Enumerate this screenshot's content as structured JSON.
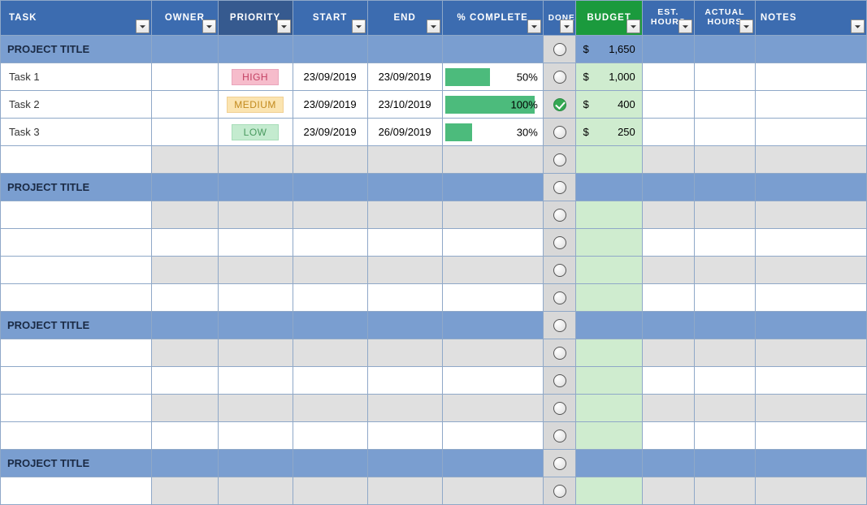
{
  "headers": {
    "task": "TASK",
    "owner": "OWNER",
    "priority": "PRIORITY",
    "start": "START",
    "end": "END",
    "pct": "% COMPLETE",
    "done": "DONE",
    "budget": "BUDGET",
    "est_hours": "EST. HOURS",
    "actual_hours": "ACTUAL HOURS",
    "notes": "NOTES"
  },
  "sections": [
    {
      "title": "PROJECT TITLE",
      "budget_currency": "$",
      "budget_total": "1,650",
      "tasks": [
        {
          "name": "Task 1",
          "priority": "HIGH",
          "prio_class": "prio-high",
          "start": "23/09/2019",
          "end": "23/09/2019",
          "pct": 50,
          "pct_text": "50%",
          "done": false,
          "currency": "$",
          "budget": "1,000"
        },
        {
          "name": "Task 2",
          "priority": "MEDIUM",
          "prio_class": "prio-medium",
          "start": "23/09/2019",
          "end": "23/10/2019",
          "pct": 100,
          "pct_text": "100%",
          "done": true,
          "currency": "$",
          "budget": "400"
        },
        {
          "name": "Task 3",
          "priority": "LOW",
          "prio_class": "prio-low",
          "start": "23/09/2019",
          "end": "26/09/2019",
          "pct": 30,
          "pct_text": "30%",
          "done": false,
          "currency": "$",
          "budget": "250"
        }
      ],
      "blank_rows_after": 1
    },
    {
      "title": "PROJECT TITLE",
      "tasks": [],
      "blank_rows_after": 4
    },
    {
      "title": "PROJECT TITLE",
      "tasks": [],
      "blank_rows_after": 4
    },
    {
      "title": "PROJECT TITLE",
      "tasks": [],
      "blank_rows_after": 1
    }
  ]
}
